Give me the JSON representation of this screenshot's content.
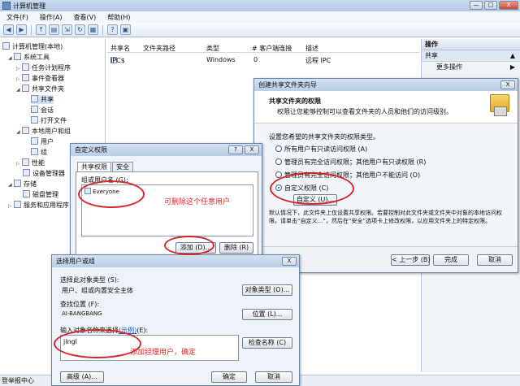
{
  "window": {
    "title": "计算机管理",
    "buttons": [
      "—",
      "□",
      "X"
    ]
  },
  "menu": [
    "文件(F)",
    "操作(A)",
    "查看(V)",
    "帮助(H)"
  ],
  "toolbar_icons": [
    "back-icon",
    "forward-icon",
    "up-icon",
    "show-hide-tree-icon",
    "export-icon",
    "refresh-icon",
    "properties-icon",
    "help-icon",
    "help-topic-icon"
  ],
  "tree": [
    {
      "label": "计算机管理(本地)"
    },
    {
      "label": "系统工具"
    },
    {
      "label": "任务计划程序"
    },
    {
      "label": "事件查看器"
    },
    {
      "label": "共享文件夹"
    },
    {
      "label": "共享"
    },
    {
      "label": "会话"
    },
    {
      "label": "打开文件"
    },
    {
      "label": "本地用户和组"
    },
    {
      "label": "用户"
    },
    {
      "label": "组"
    },
    {
      "label": "性能"
    },
    {
      "label": "设备管理器"
    },
    {
      "label": "存储"
    },
    {
      "label": "磁盘管理"
    },
    {
      "label": "服务和应用程序"
    }
  ],
  "list": {
    "columns": [
      "共享名",
      "文件夹路径",
      "类型",
      "# 客户端连接",
      "描述"
    ],
    "rows": [
      {
        "name": "IPC$",
        "path": "",
        "type": "Windows",
        "clients": "0",
        "desc": "远程 IPC"
      }
    ]
  },
  "actions": {
    "header": "操作",
    "section": "共享",
    "more": "更多操作",
    "more_arrow": "▶",
    "section_arrow": "▲"
  },
  "status": "登举报中心",
  "wizard": {
    "title": "创建共享文件夹向导",
    "close": "X",
    "head_title": "共享文件夹的权限",
    "head_desc": "权限让您能够控制可以查看文件夹的人员和他们的访问级别。",
    "prompt": "设置您希望的共享文件夹的权限类型。",
    "options": [
      "所有用户有只读访问权限 (A)",
      "管理员有完全访问权限；其他用户有只读权限 (R)",
      "管理员有完全访问权限；其他用户不能访问 (O)",
      "自定义权限 (C)"
    ],
    "custom_button": "自定义 (U)...",
    "info": "默认情况下，此文件夹上仅设置共享权限。若要控制对此文件夹或文件夹中对象的本地访问权限，请单击“自定义...”，然后在“安全”选项卡上修改权限，以应用文件夹上的特定权限。",
    "back": "< 上一步 (B)",
    "finish": "完成",
    "cancel": "取消"
  },
  "perm": {
    "title": "自定义权限",
    "help": "?",
    "close": "X",
    "tabs": [
      "共享权限",
      "安全"
    ],
    "group_label": "组或用户名 (G):",
    "user": "Everyone",
    "add": "添加 (D)...",
    "remove": "删除 (R)"
  },
  "select": {
    "title": "选择用户或组",
    "close": "X",
    "type_label": "选择此对象类型 (S):",
    "type_value": "用户、组或内置安全主体",
    "type_button": "对象类型 (O)...",
    "loc_label": "查找位置 (F):",
    "loc_value": "AI-BANGBANG",
    "loc_button": "位置 (L)...",
    "names_label": "输入对象名称来选择",
    "names_link": "(示例)",
    "names_suffix": "(E):",
    "names_value": "jingl",
    "check_button": "检查名称 (C)",
    "advanced": "高级 (A)...",
    "ok": "确定",
    "cancel": "取消"
  },
  "annotations": {
    "note1": "可删除这个任意用户",
    "note2": "添加经理用户，确定",
    "color": "#d4262a"
  }
}
